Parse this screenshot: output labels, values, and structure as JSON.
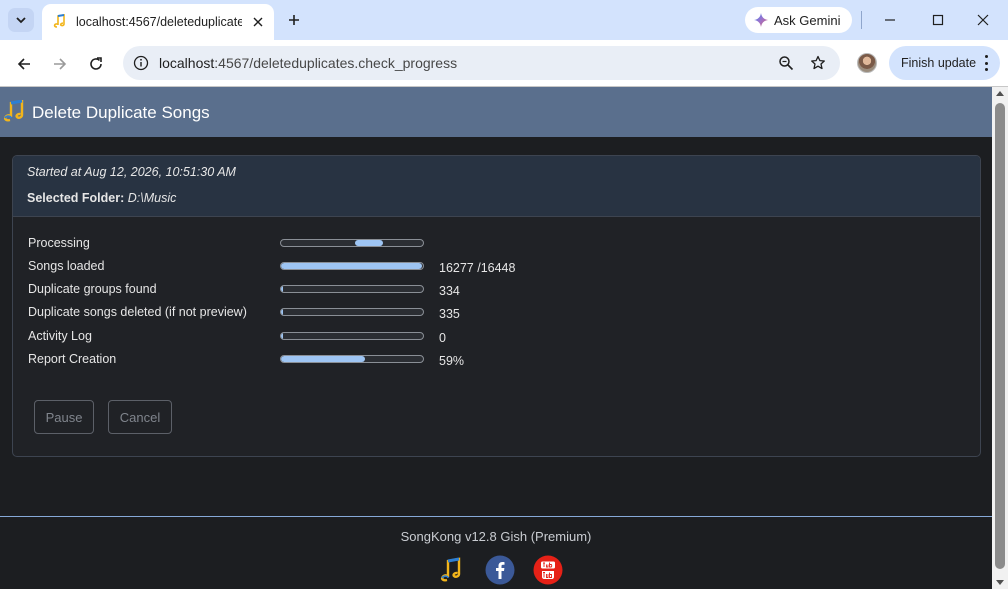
{
  "browser": {
    "tab_title": "localhost:4567/deleteduplicates.check_progress",
    "ask_gemini": "Ask Gemini",
    "url_host": "localhost",
    "url_rest": ":4567/deleteduplicates.check_progress",
    "finish_update": "Finish update"
  },
  "app": {
    "title": "Delete Duplicate Songs"
  },
  "job": {
    "started": "Started at Aug 12, 2026, 10:51:30 AM",
    "folder_label": "Selected Folder:",
    "folder_value": "D:\\Music"
  },
  "progress": {
    "rows": [
      {
        "label": "Processing",
        "value": "",
        "fraction": null,
        "indeterminate": true
      },
      {
        "label": "Songs loaded",
        "value": "16277 /16448",
        "fraction": 0.9896
      },
      {
        "label": "Duplicate groups found",
        "value": "334",
        "fraction": 0.0
      },
      {
        "label": "Duplicate songs deleted (if not preview)",
        "value": "335",
        "fraction": 0.0
      },
      {
        "label": "Activity Log",
        "value": "0",
        "fraction": 0.0
      },
      {
        "label": "Report Creation",
        "value": "59%",
        "fraction": 0.59
      }
    ]
  },
  "buttons": {
    "pause": "Pause",
    "cancel": "Cancel"
  },
  "footer": {
    "version": "SongKong v12.8 Gish (Premium)"
  },
  "colors": {
    "header_bg": "#5a6f8d",
    "progress_fill": "#9ec5f3",
    "card_head_bg": "#283342",
    "facebook": "#3b5998",
    "youtube": "#e62117"
  }
}
